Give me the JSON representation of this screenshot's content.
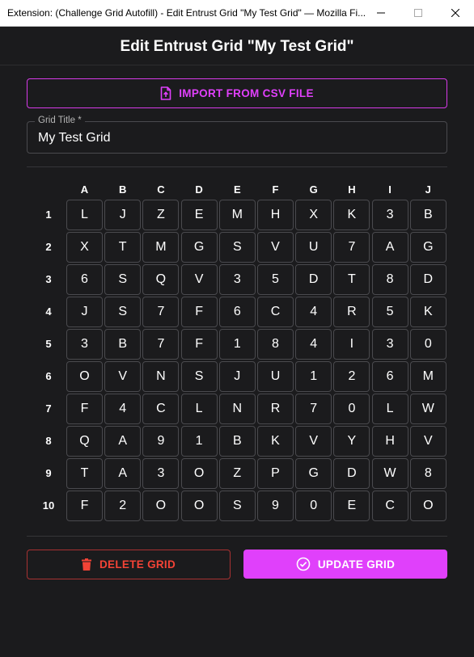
{
  "window": {
    "title": "Extension: (Challenge Grid Autofill) - Edit Entrust Grid \"My Test Grid\" — Mozilla Fi..."
  },
  "header": {
    "title": "Edit Entrust Grid \"My Test Grid\""
  },
  "import_button": {
    "label": "IMPORT FROM CSV FILE",
    "icon": "file-upload-icon"
  },
  "grid_title_field": {
    "label": "Grid Title *",
    "value": "My Test Grid"
  },
  "grid": {
    "columns": [
      "A",
      "B",
      "C",
      "D",
      "E",
      "F",
      "G",
      "H",
      "I",
      "J"
    ],
    "rows": [
      "1",
      "2",
      "3",
      "4",
      "5",
      "6",
      "7",
      "8",
      "9",
      "10"
    ],
    "cells": [
      [
        "L",
        "J",
        "Z",
        "E",
        "M",
        "H",
        "X",
        "K",
        "3",
        "B"
      ],
      [
        "X",
        "T",
        "M",
        "G",
        "S",
        "V",
        "U",
        "7",
        "A",
        "G"
      ],
      [
        "6",
        "S",
        "Q",
        "V",
        "3",
        "5",
        "D",
        "T",
        "8",
        "D"
      ],
      [
        "J",
        "S",
        "7",
        "F",
        "6",
        "C",
        "4",
        "R",
        "5",
        "K"
      ],
      [
        "3",
        "B",
        "7",
        "F",
        "1",
        "8",
        "4",
        "I",
        "3",
        "0"
      ],
      [
        "O",
        "V",
        "N",
        "S",
        "J",
        "U",
        "1",
        "2",
        "6",
        "M"
      ],
      [
        "F",
        "4",
        "C",
        "L",
        "N",
        "R",
        "7",
        "0",
        "L",
        "W"
      ],
      [
        "Q",
        "A",
        "9",
        "1",
        "B",
        "K",
        "V",
        "Y",
        "H",
        "V"
      ],
      [
        "T",
        "A",
        "3",
        "O",
        "Z",
        "P",
        "G",
        "D",
        "W",
        "8"
      ],
      [
        "F",
        "2",
        "O",
        "O",
        "S",
        "9",
        "0",
        "E",
        "C",
        "O"
      ]
    ]
  },
  "delete_button": {
    "label": "DELETE GRID",
    "icon": "trash-icon"
  },
  "update_button": {
    "label": "UPDATE GRID",
    "icon": "check-circle-icon"
  },
  "colors": {
    "accent": "#e040fb",
    "danger": "#f44336",
    "background": "#1b1b1d"
  }
}
